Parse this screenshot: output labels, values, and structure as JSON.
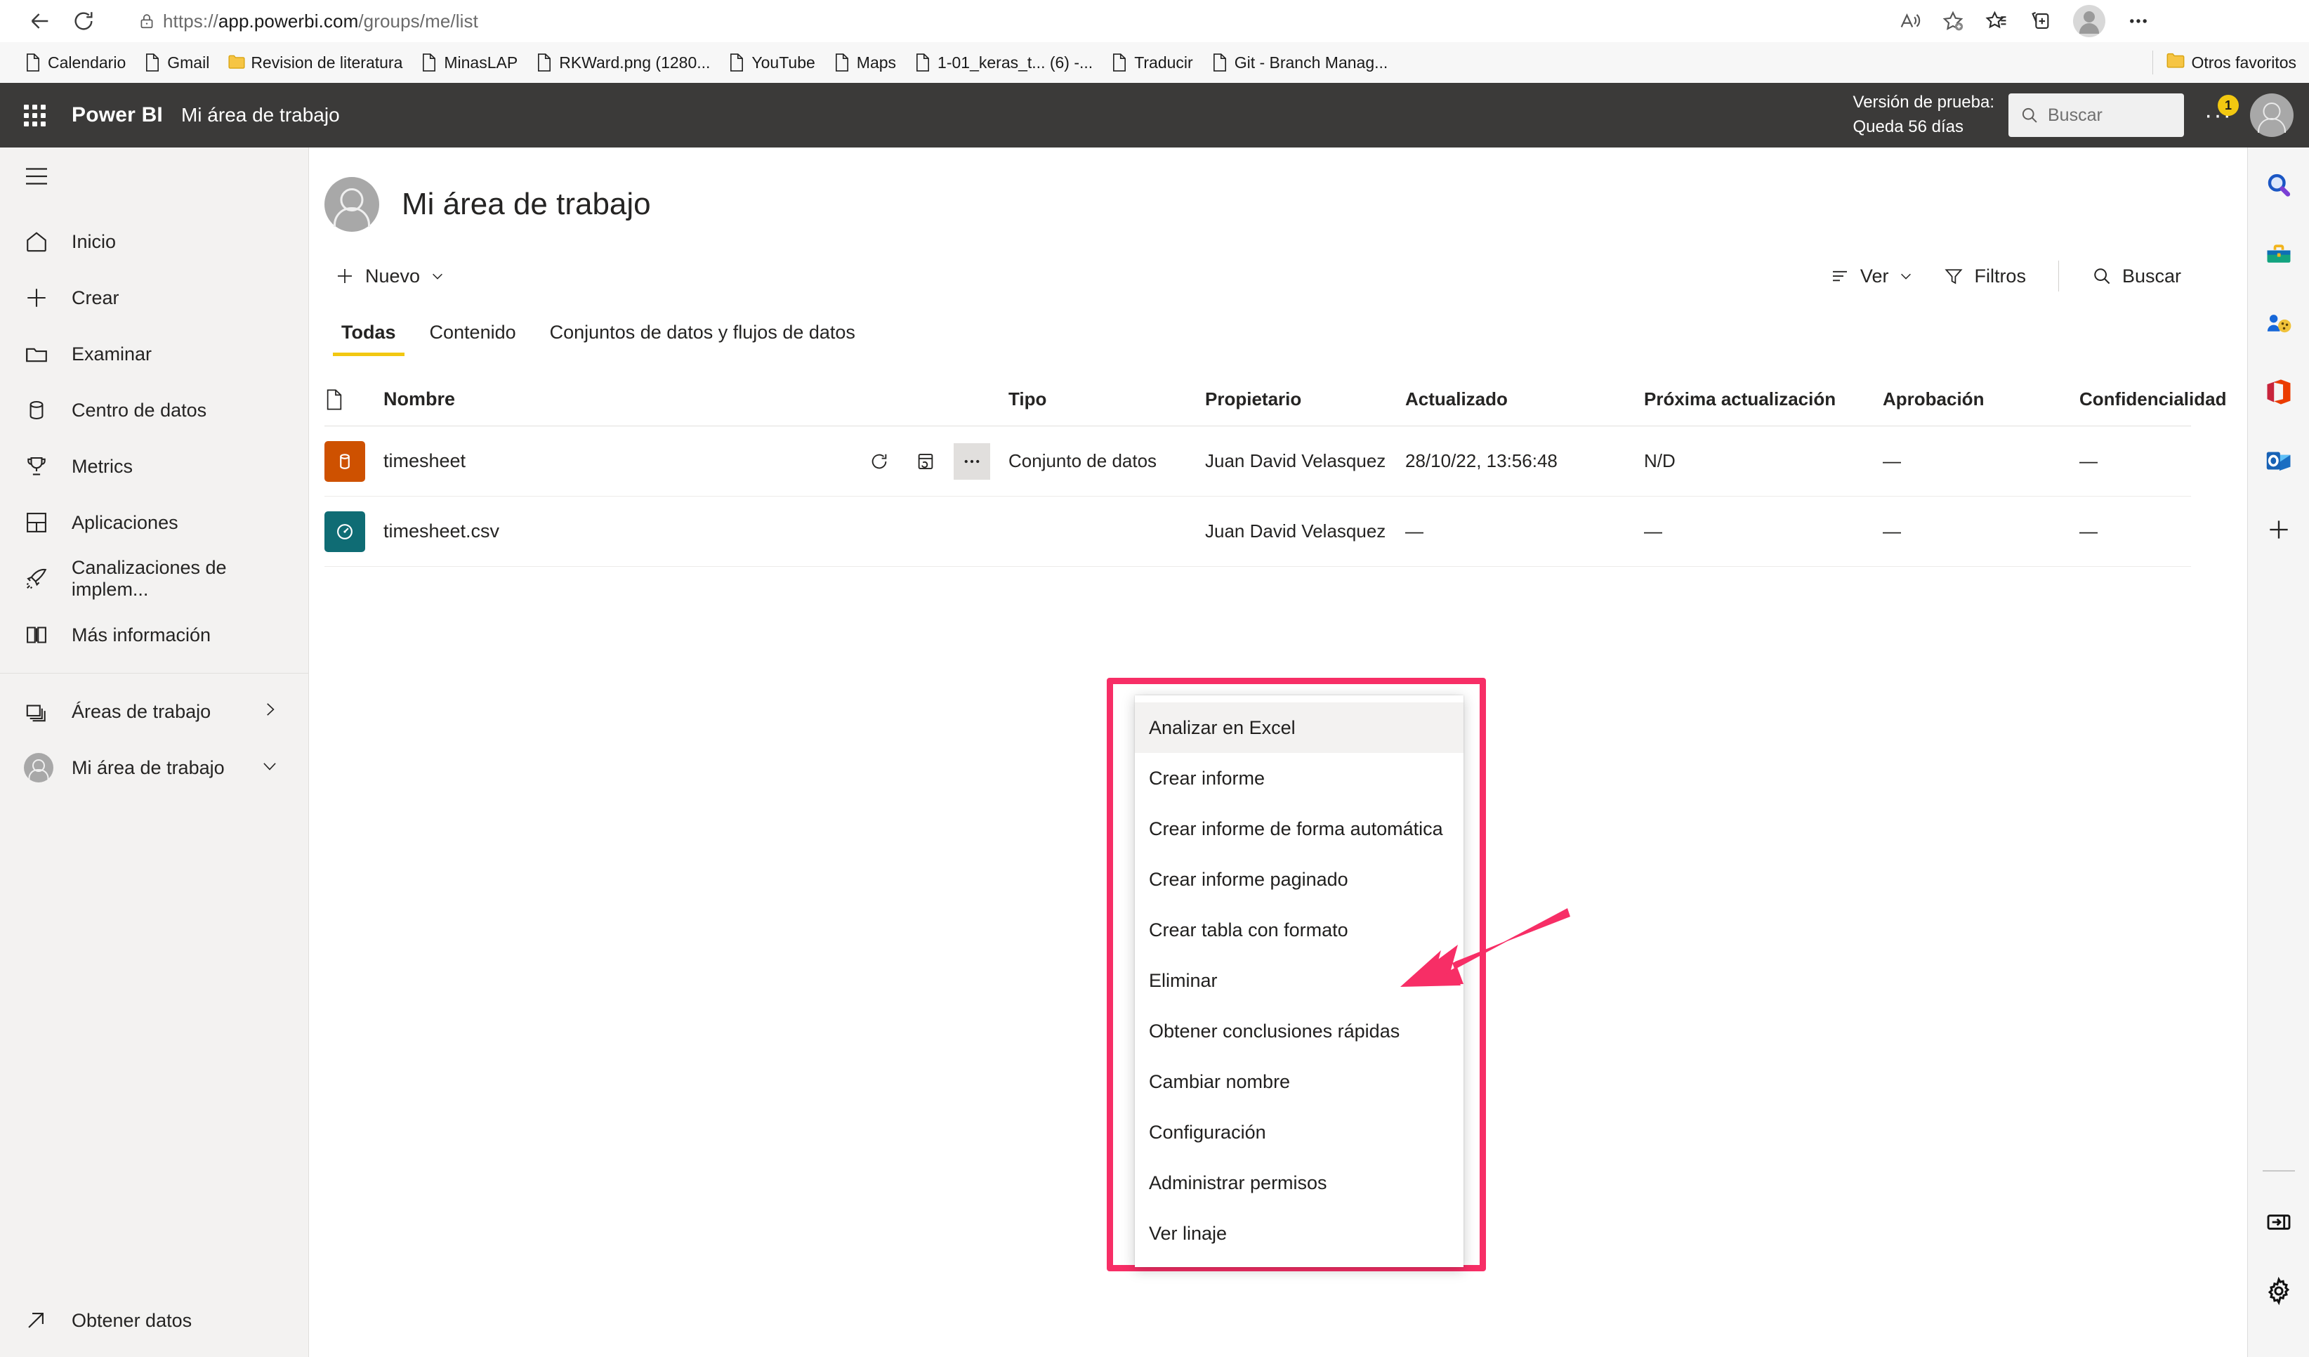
{
  "browser": {
    "back_label": "Atrás",
    "refresh_label": "Actualizar",
    "url_scheme": "https://",
    "url_host": "app.powerbi.com",
    "url_path": "/groups/me/list",
    "bookmarks": [
      {
        "label": "Calendario",
        "icon": "page-icon"
      },
      {
        "label": "Gmail",
        "icon": "page-icon"
      },
      {
        "label": "Revision de literatura",
        "icon": "folder-icon"
      },
      {
        "label": "MinasLAP",
        "icon": "page-icon"
      },
      {
        "label": "RKWard.png (1280...",
        "icon": "page-icon"
      },
      {
        "label": "YouTube",
        "icon": "page-icon"
      },
      {
        "label": "Maps",
        "icon": "page-icon"
      },
      {
        "label": "1-01_keras_t... (6) -...",
        "icon": "page-icon"
      },
      {
        "label": "Traducir",
        "icon": "page-icon"
      },
      {
        "label": "Git - Branch Manag...",
        "icon": "page-icon"
      }
    ],
    "other_favorites": "Otros favoritos"
  },
  "pbi_header": {
    "brand": "Power BI",
    "subtitle": "Mi área de trabajo",
    "trial_line1": "Versión de prueba:",
    "trial_line2": "Queda 56 días",
    "search_placeholder": "Buscar",
    "notification_count": "1",
    "more_dots": "···"
  },
  "sidebar": {
    "items": [
      {
        "label": "Inicio",
        "icon": "home-icon"
      },
      {
        "label": "Crear",
        "icon": "plus-icon"
      },
      {
        "label": "Examinar",
        "icon": "folder-icon"
      },
      {
        "label": "Centro de datos",
        "icon": "database-icon"
      },
      {
        "label": "Metrics",
        "icon": "trophy-icon"
      },
      {
        "label": "Aplicaciones",
        "icon": "apps-grid-icon"
      },
      {
        "label": "Canalizaciones de implem...",
        "icon": "rocket-icon"
      },
      {
        "label": "Más información",
        "icon": "book-icon"
      }
    ],
    "workspaces": {
      "label": "Áreas de trabajo",
      "icon": "workspaces-icon",
      "chevron": "chevron-right-icon"
    },
    "my_workspace": {
      "label": "Mi área de trabajo",
      "icon": "avatar-icon",
      "chevron": "chevron-down-icon"
    },
    "get_data": {
      "label": "Obtener datos",
      "icon": "arrow-up-right-icon"
    }
  },
  "workspace": {
    "title": "Mi área de trabajo",
    "new_button": "Nuevo",
    "view_button": "Ver",
    "filters_button": "Filtros",
    "search_button": "Buscar"
  },
  "tabs": [
    {
      "label": "Todas",
      "active": true
    },
    {
      "label": "Contenido",
      "active": false
    },
    {
      "label": "Conjuntos de datos y flujos de datos",
      "active": false
    }
  ],
  "table": {
    "headers": {
      "icon": "",
      "name": "Nombre",
      "type": "Tipo",
      "owner": "Propietario",
      "updated": "Actualizado",
      "next_refresh": "Próxima actualización",
      "approval": "Aprobación",
      "sensitivity": "Confidencialidad"
    },
    "rows": [
      {
        "name": "timesheet",
        "icon": "dataset-tile-icon",
        "type": "Conjunto de datos",
        "owner": "Juan David Velasquez",
        "updated": "28/10/22, 13:56:48",
        "next_refresh": "N/D",
        "approval": "—",
        "sensitivity": "—",
        "actions": [
          "refresh-icon",
          "schedule-refresh-icon",
          "more-options-icon"
        ]
      },
      {
        "name": "timesheet.csv",
        "icon": "dataflow-tile-icon",
        "type": "",
        "owner": "Juan David Velasquez",
        "updated": "—",
        "next_refresh": "—",
        "approval": "—",
        "sensitivity": "—",
        "actions": []
      }
    ]
  },
  "context_menu": {
    "items": [
      {
        "label": "Analizar en Excel",
        "hover": true
      },
      {
        "label": "Crear informe",
        "hover": false
      },
      {
        "label": "Crear informe de forma automática",
        "hover": false
      },
      {
        "label": "Crear informe paginado",
        "hover": false
      },
      {
        "label": "Crear tabla con formato",
        "hover": false
      },
      {
        "label": "Eliminar",
        "hover": false
      },
      {
        "label": "Obtener conclusiones rápidas",
        "hover": false
      },
      {
        "label": "Cambiar nombre",
        "hover": false
      },
      {
        "label": "Configuración",
        "hover": false
      },
      {
        "label": "Administrar permisos",
        "hover": false
      },
      {
        "label": "Ver linaje",
        "hover": false
      }
    ],
    "highlight_color": "#f72e66",
    "arrow_color": "#f72e66"
  },
  "right_rail": {
    "icons": [
      "search-magnifier-icon",
      "toolbox-icon",
      "games-icon",
      "office-icon",
      "outlook-icon",
      "add-app-icon"
    ],
    "bottom_icons": [
      "collapse-panel-icon",
      "settings-gear-icon"
    ]
  }
}
